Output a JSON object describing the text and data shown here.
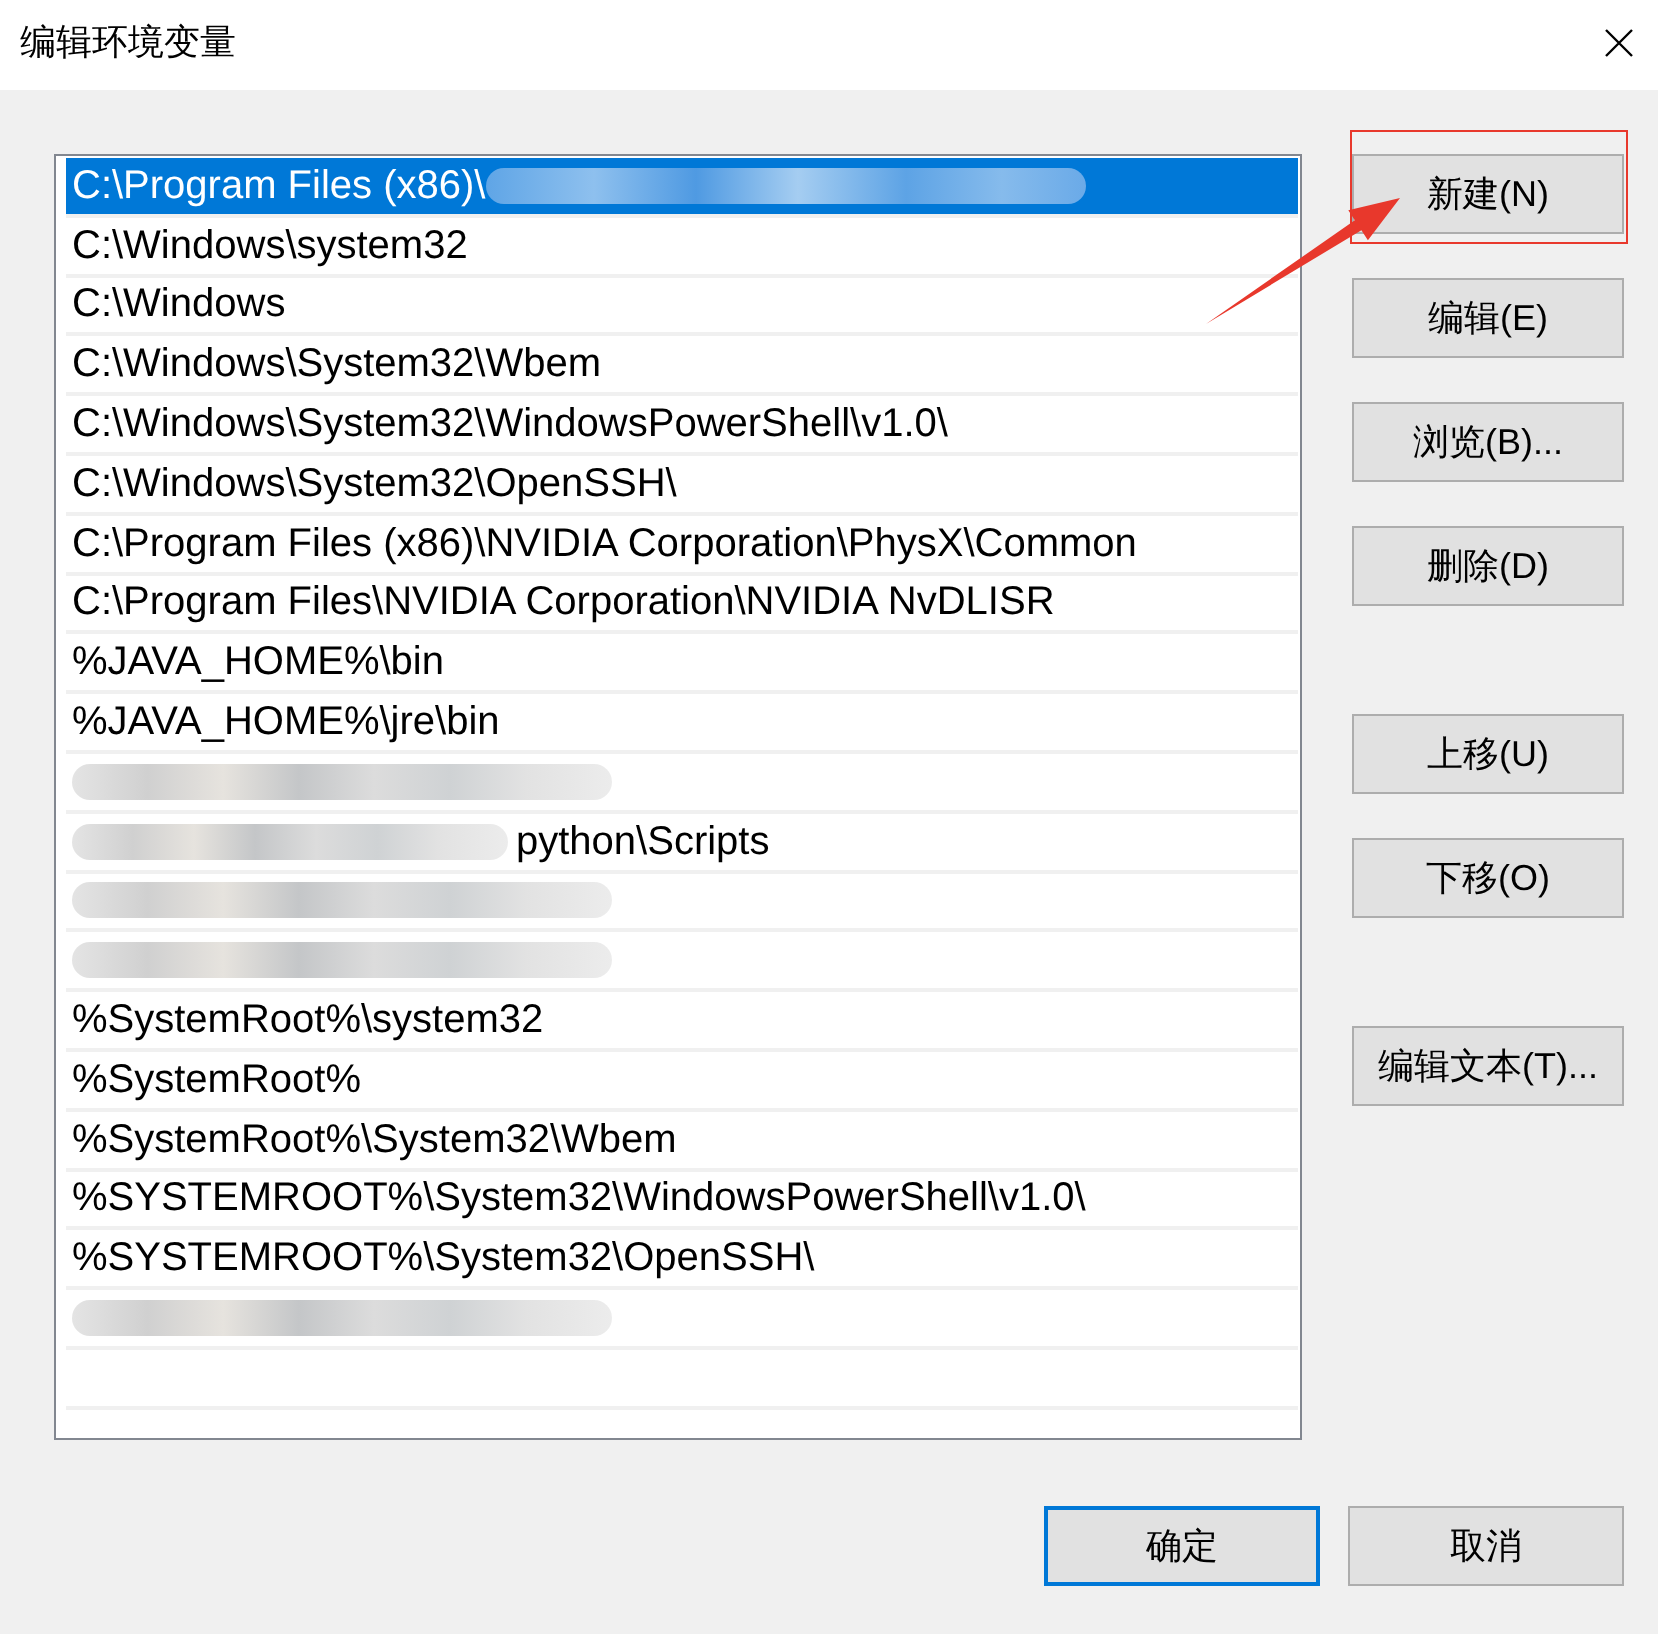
{
  "window": {
    "title": "编辑环境变量"
  },
  "paths": [
    {
      "text": "C:\\Program Files (x86)\\",
      "blurred": true,
      "selected": true
    },
    {
      "text": "C:\\Windows\\system32",
      "blurred": false,
      "selected": false
    },
    {
      "text": "C:\\Windows",
      "blurred": false,
      "selected": false
    },
    {
      "text": "C:\\Windows\\System32\\Wbem",
      "blurred": false,
      "selected": false
    },
    {
      "text": "C:\\Windows\\System32\\WindowsPowerShell\\v1.0\\",
      "blurred": false,
      "selected": false
    },
    {
      "text": "C:\\Windows\\System32\\OpenSSH\\",
      "blurred": false,
      "selected": false
    },
    {
      "text": "C:\\Program Files (x86)\\NVIDIA Corporation\\PhysX\\Common",
      "blurred": false,
      "selected": false
    },
    {
      "text": "C:\\Program Files\\NVIDIA Corporation\\NVIDIA NvDLISR",
      "blurred": false,
      "selected": false
    },
    {
      "text": "%JAVA_HOME%\\bin",
      "blurred": false,
      "selected": false
    },
    {
      "text": "%JAVA_HOME%\\jre\\bin",
      "blurred": false,
      "selected": false
    },
    {
      "blurred": true,
      "selected": false
    },
    {
      "blurred": true,
      "text_after": "python\\Scripts",
      "selected": false
    },
    {
      "blurred": true,
      "selected": false
    },
    {
      "blurred": true,
      "selected": false
    },
    {
      "text": "%SystemRoot%\\system32",
      "blurred": false,
      "selected": false
    },
    {
      "text": "%SystemRoot%",
      "blurred": false,
      "selected": false
    },
    {
      "text": "%SystemRoot%\\System32\\Wbem",
      "blurred": false,
      "selected": false
    },
    {
      "text": "%SYSTEMROOT%\\System32\\WindowsPowerShell\\v1.0\\",
      "blurred": false,
      "selected": false
    },
    {
      "text": "%SYSTEMROOT%\\System32\\OpenSSH\\",
      "blurred": false,
      "selected": false
    },
    {
      "blurred": true,
      "selected": false
    }
  ],
  "side_button_groups": [
    {
      "buttons": [
        {
          "label": "新建(N)",
          "highlighted": true
        },
        {
          "label": "编辑(E)",
          "highlighted": false
        },
        {
          "label": "浏览(B)...",
          "highlighted": false
        },
        {
          "label": "删除(D)",
          "highlighted": false
        }
      ]
    },
    {
      "buttons": [
        {
          "label": "上移(U)",
          "highlighted": false
        },
        {
          "label": "下移(O)",
          "highlighted": false
        }
      ]
    },
    {
      "buttons": [
        {
          "label": "编辑文本(T)...",
          "highlighted": false
        }
      ]
    }
  ],
  "footer_buttons": [
    {
      "label": "确定",
      "default": true
    },
    {
      "label": "取消",
      "default": false
    }
  ]
}
